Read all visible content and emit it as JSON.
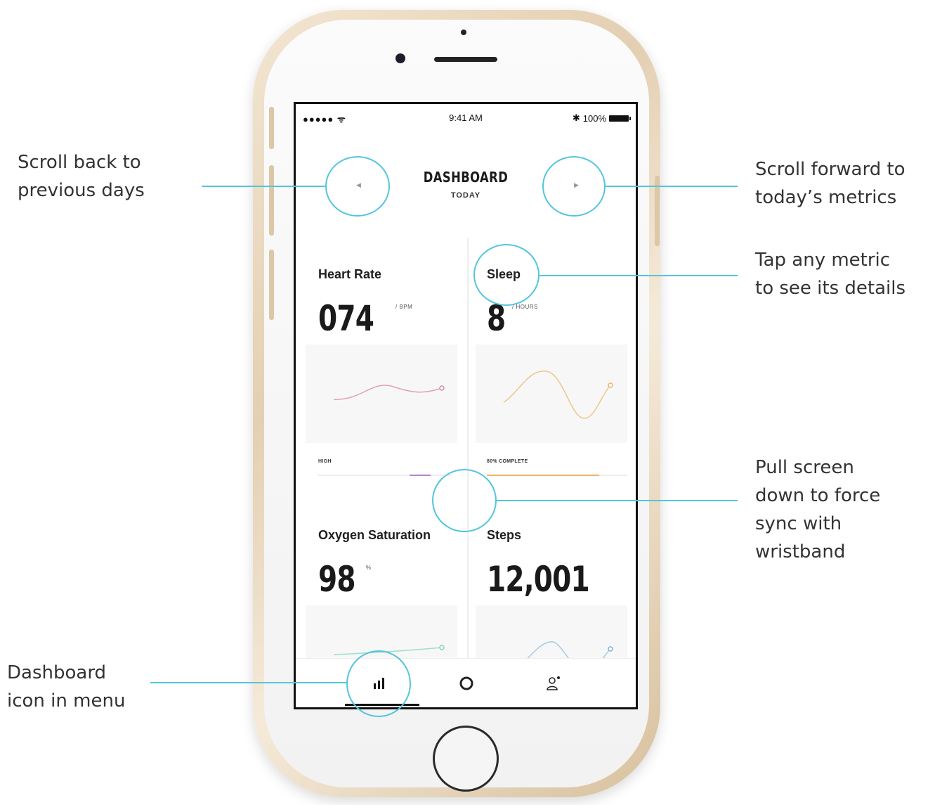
{
  "status_bar": {
    "signal": "●●●●● ᯤ",
    "time": "9:41 AM",
    "bluetooth": "✱",
    "battery": "100%"
  },
  "header": {
    "title": "DASHBOARD",
    "subtitle": "TODAY",
    "prev_arrow": "◀",
    "next_arrow": "▶"
  },
  "metrics": {
    "heart_rate": {
      "title": "Heart Rate",
      "value": "074",
      "unit": "/ BPM",
      "foot": "HIGH",
      "accent": "#d98a9e"
    },
    "sleep": {
      "title": "Sleep",
      "value": "8",
      "unit": "/ HOURS",
      "foot": "80% COMPLETE",
      "accent": "#eab765",
      "progress": 0.8
    },
    "oxygen": {
      "title": "Oxygen Saturation",
      "value": "98",
      "unit": "%",
      "accent": "#7fd4be"
    },
    "steps": {
      "title": "Steps",
      "value": "12,001",
      "accent": "#7fb3d6"
    }
  },
  "tabbar": {
    "items": [
      {
        "icon": "bar-chart-icon"
      },
      {
        "icon": "ring-icon"
      },
      {
        "icon": "profile-icon"
      }
    ]
  },
  "annotations": {
    "prev": "Scroll back to\nprevious days",
    "next": "Scroll forward to\ntoday’s metrics",
    "tap": "Tap any metric\nto see its details",
    "pull": "Pull screen\ndown to force\nsync with\nwristband",
    "menu": "Dashboard\nicon in menu"
  },
  "colors": {
    "callout": "#53c5dd"
  }
}
